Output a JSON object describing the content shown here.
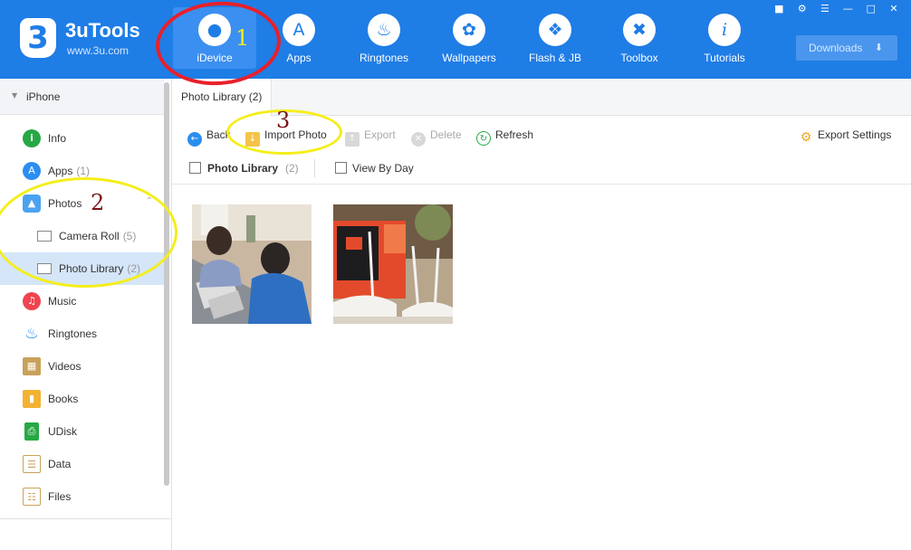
{
  "app": {
    "name": "3uTools",
    "url": "www.3u.com",
    "logo_glyph": "3"
  },
  "nav": [
    {
      "label": "iDevice",
      "icon": "apple-icon",
      "active": true
    },
    {
      "label": "Apps",
      "icon": "appstore-icon",
      "active": false
    },
    {
      "label": "Ringtones",
      "icon": "bell-icon",
      "active": false
    },
    {
      "label": "Wallpapers",
      "icon": "flower-icon",
      "active": false
    },
    {
      "label": "Flash & JB",
      "icon": "dropbox-icon",
      "active": false
    },
    {
      "label": "Toolbox",
      "icon": "tools-icon",
      "active": false
    },
    {
      "label": "Tutorials",
      "icon": "info-icon",
      "active": false
    }
  ],
  "header_right": {
    "downloads_label": "Downloads"
  },
  "sidebar": {
    "device": "iPhone",
    "items": [
      {
        "label": "Info",
        "count": "",
        "icon": "info-icon"
      },
      {
        "label": "Apps",
        "count": "(1)",
        "icon": "appstore-icon"
      },
      {
        "label": "Photos",
        "count": "",
        "icon": "photos-icon"
      },
      {
        "label": "Camera Roll",
        "count": "(5)",
        "icon": "folder-icon"
      },
      {
        "label": "Photo Library",
        "count": "(2)",
        "icon": "folder-icon"
      },
      {
        "label": "Music",
        "count": "",
        "icon": "music-icon"
      },
      {
        "label": "Ringtones",
        "count": "",
        "icon": "bell-icon"
      },
      {
        "label": "Videos",
        "count": "",
        "icon": "film-icon"
      },
      {
        "label": "Books",
        "count": "",
        "icon": "book-icon"
      },
      {
        "label": "UDisk",
        "count": "",
        "icon": "usb-icon"
      },
      {
        "label": "Data",
        "count": "",
        "icon": "data-icon"
      },
      {
        "label": "Files",
        "count": "",
        "icon": "files-icon"
      }
    ]
  },
  "tab": {
    "label": "Photo Library (2)"
  },
  "toolbar": {
    "back": "Back",
    "import": "Import Photo",
    "export": "Export",
    "delete": "Delete",
    "refresh": "Refresh",
    "export_settings": "Export Settings"
  },
  "filters": {
    "photo_library": "Photo Library",
    "photo_library_count": "(2)",
    "view_by_day": "View By Day"
  },
  "annotations": {
    "one": "1",
    "two": "2",
    "three": "3"
  },
  "colors": {
    "header_blue": "#1f7de6",
    "selected_bg": "#d5e6f9",
    "annotation_red": "#e8202a",
    "annotation_yellow": "#f4ee1c",
    "annotation_dark_red": "#7a1616"
  }
}
